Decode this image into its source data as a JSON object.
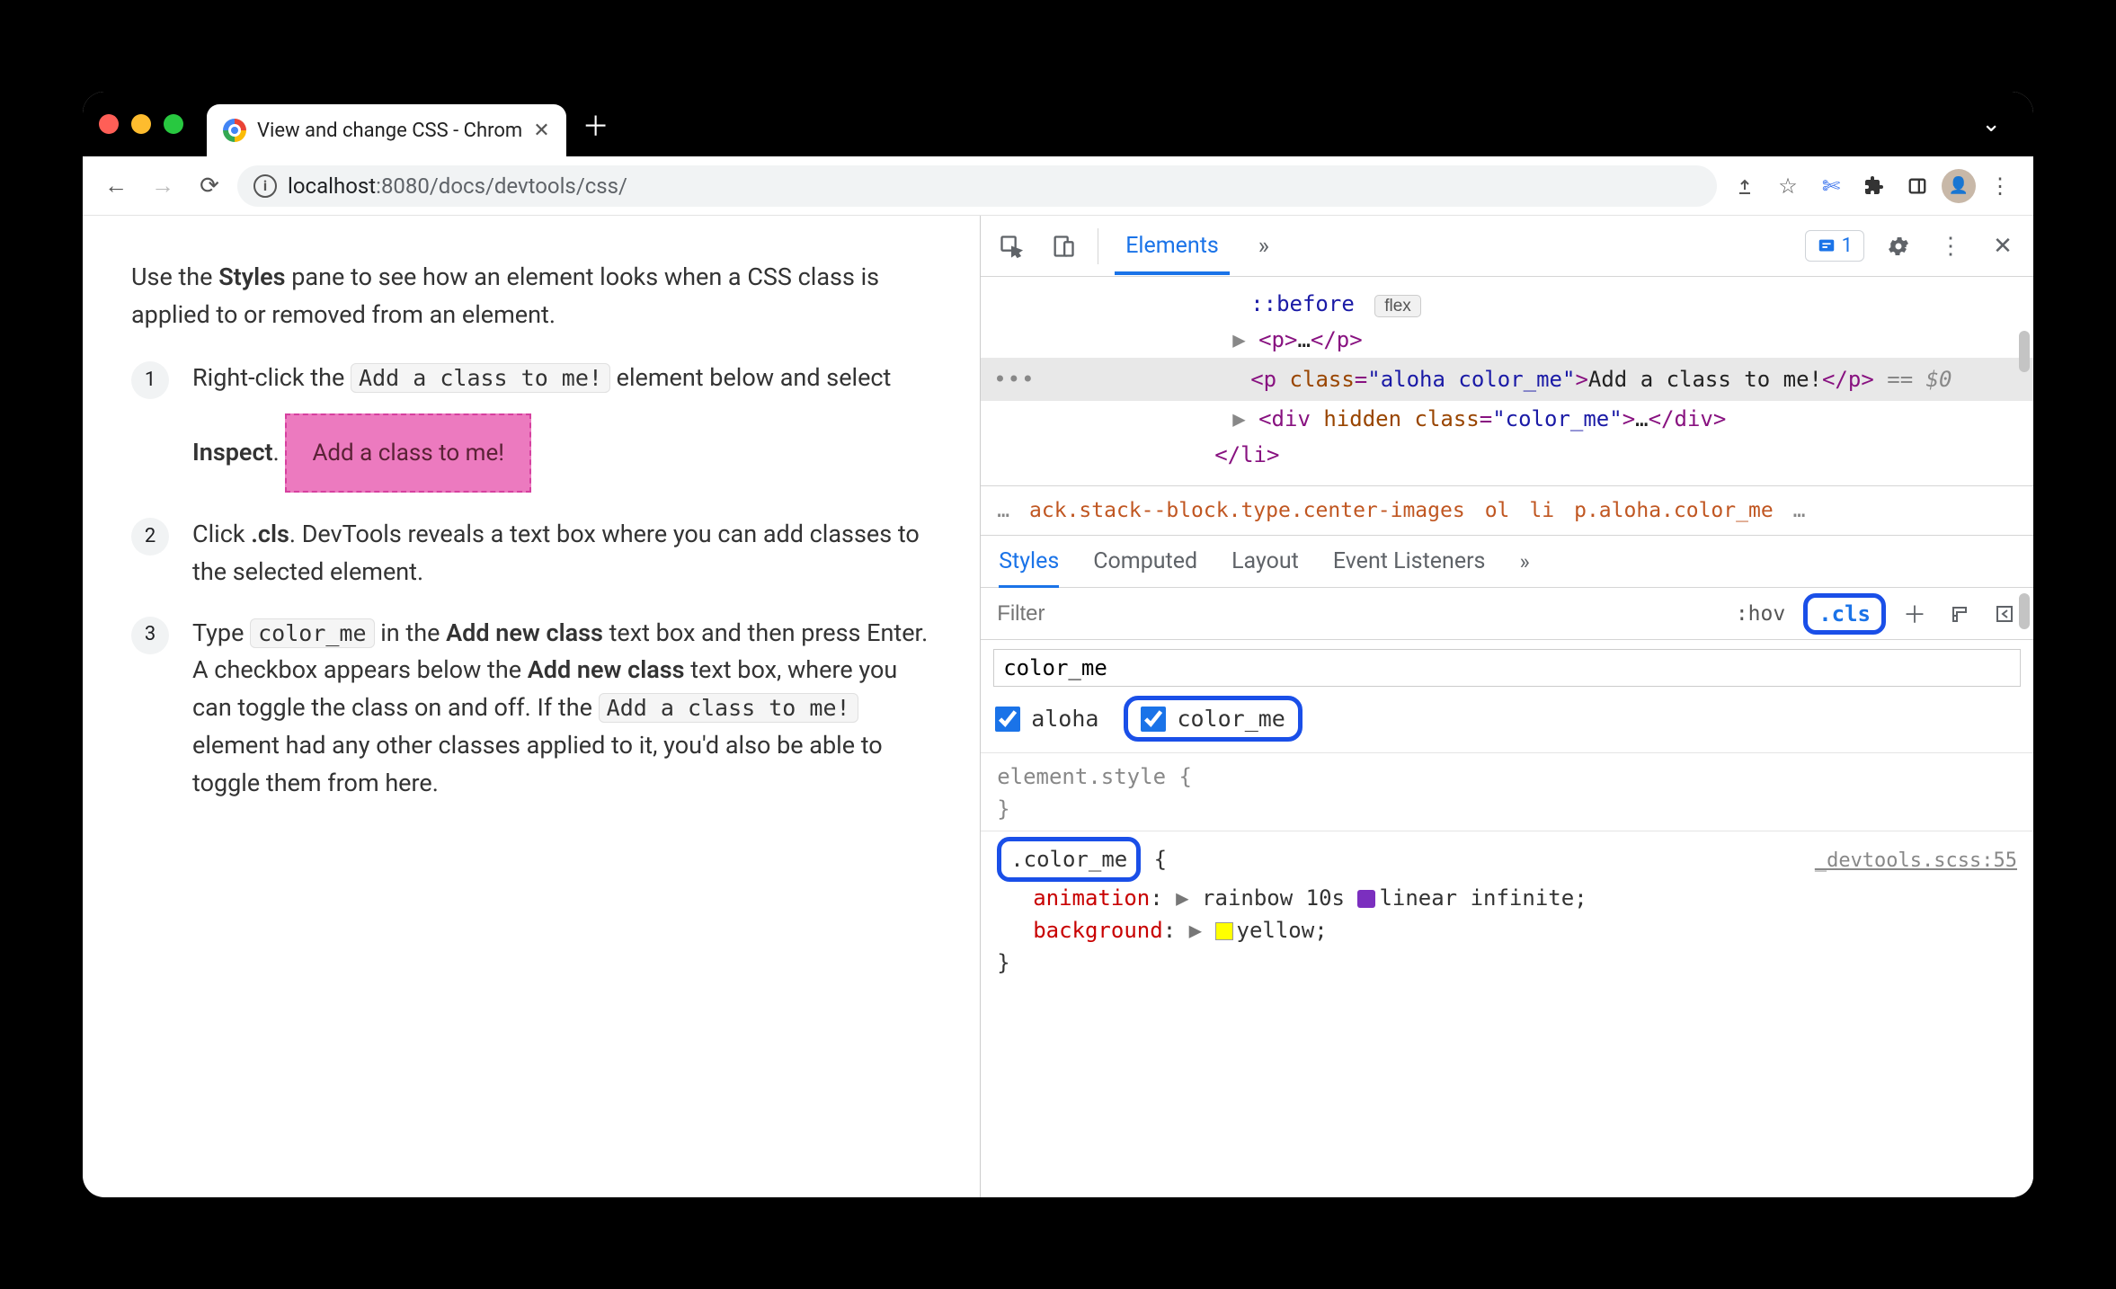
{
  "browser": {
    "tab_title": "View and change CSS - Chrom",
    "url_host": "localhost",
    "url_port": ":8080",
    "url_path": "/docs/devtools/css/"
  },
  "page": {
    "intro_prefix": "Use the ",
    "intro_strong": "Styles",
    "intro_suffix": " pane to see how an element looks when a CSS class is applied to or removed from an element.",
    "step1_a": "Right-click the ",
    "step1_code": "Add a class to me!",
    "step1_b": " element below and select ",
    "step1_strong": "Inspect",
    "step1_c": ".",
    "highlight_box": "Add a class to me!",
    "step2_a": "Click ",
    "step2_strong": ".cls",
    "step2_b": ". DevTools reveals a text box where you can add classes to the selected element.",
    "step3_a": "Type ",
    "step3_code1": "color_me",
    "step3_b": " in the ",
    "step3_strong1": "Add new class",
    "step3_c": " text box and then press Enter. A checkbox appears below the ",
    "step3_strong2": "Add new class",
    "step3_d": " text box, where you can toggle the class on and off. If the ",
    "step3_code2": "Add a class to me!",
    "step3_e": " element had any other classes applied to it, you'd also be able to toggle them from here."
  },
  "devtools": {
    "top_tab_elements": "Elements",
    "issue_count": "1",
    "dom": {
      "before": "::before",
      "flex_badge": "flex",
      "p_open": "<p>",
      "p_ell": "…",
      "p_close": "</p>",
      "sel_tag_open": "<p ",
      "sel_attr_name": "class",
      "sel_attr_val": "\"aloha color_me\"",
      "sel_close": ">",
      "sel_text": "Add a class to me!",
      "sel_endtag": "</p>",
      "sel_eq0": " == $0",
      "div_open": "<div ",
      "div_hidden": "hidden",
      "div_class_attr": "class",
      "div_class_val": "\"color_me\"",
      "div_close": ">",
      "div_ell": "…",
      "div_end": "</div>",
      "li_end": "</li>"
    },
    "crumb": {
      "dots1": "…",
      "seg1": "ack.stack--block.type.center-images",
      "seg2": "ol",
      "seg3": "li",
      "seg4": "p.aloha.color_me",
      "dots2": "…"
    },
    "styles_tabs": {
      "styles": "Styles",
      "computed": "Computed",
      "layout": "Layout",
      "event": "Event Listeners"
    },
    "filter_placeholder": "Filter",
    "hov": ":hov",
    "cls": ".cls",
    "cls_input_value": "color_me",
    "checkbox1": "aloha",
    "checkbox2": "color_me",
    "element_style": "element.style",
    "rule_selector": ".color_me",
    "rule_source": "_devtools.scss:55",
    "prop_animation": "animation",
    "val_animation": "rainbow 10s ",
    "val_animation2": "linear infinite",
    "prop_background": "background",
    "val_background": "yellow"
  }
}
